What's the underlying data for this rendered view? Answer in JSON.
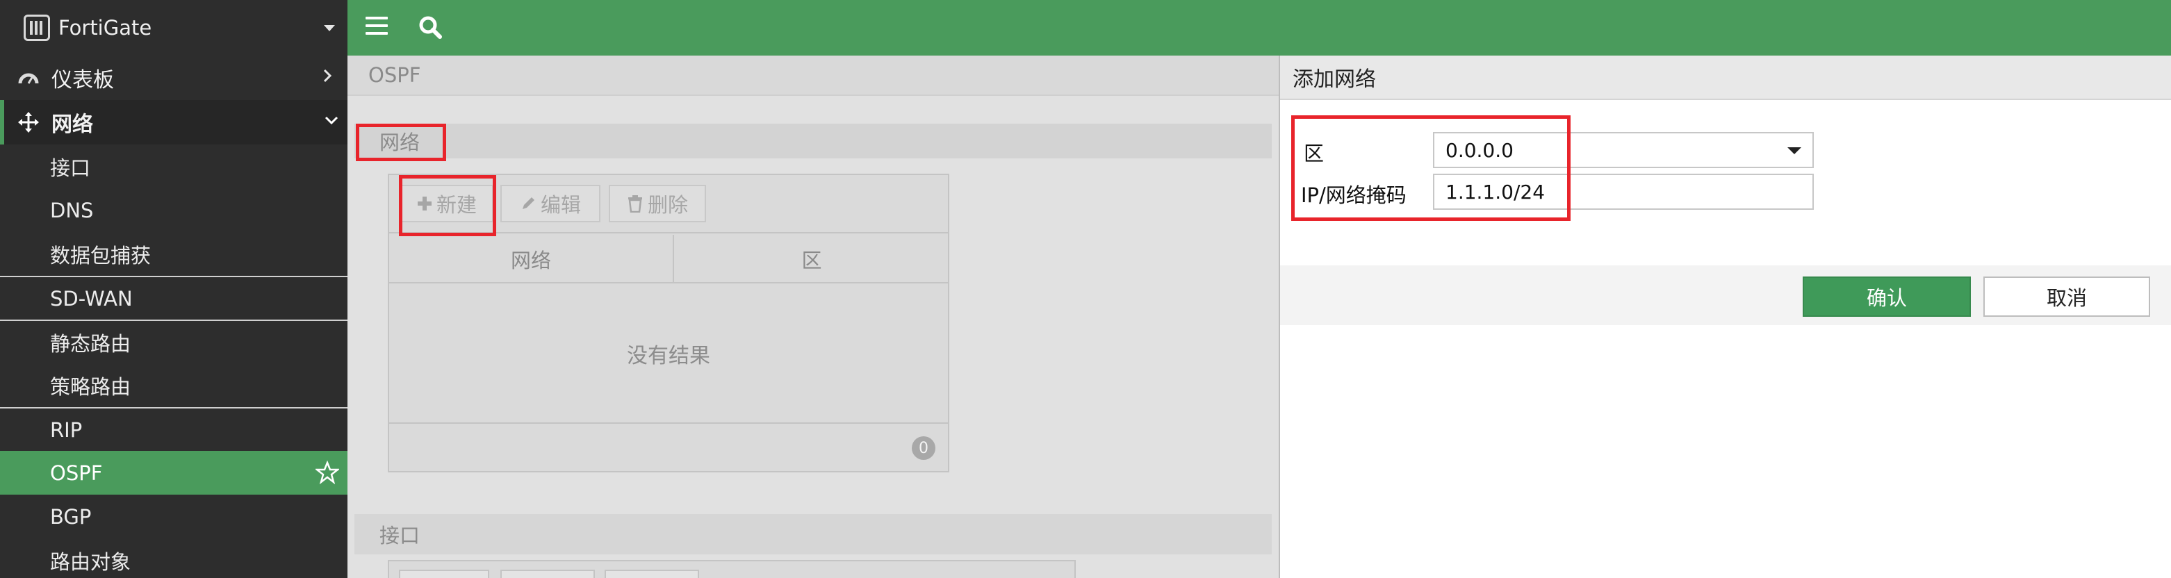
{
  "sidebar": {
    "brand": "FortiGate",
    "items": [
      {
        "label": "仪表板",
        "icon": "dashboard-icon"
      },
      {
        "label": "网络",
        "icon": "network-move-icon"
      }
    ],
    "sub_items": [
      {
        "label": "接口"
      },
      {
        "label": "DNS"
      },
      {
        "label": "数据包捕获"
      },
      {
        "label": "SD-WAN"
      },
      {
        "label": "静态路由"
      },
      {
        "label": "策略路由"
      },
      {
        "label": "RIP"
      },
      {
        "label": "OSPF",
        "selected": true
      },
      {
        "label": "BGP"
      },
      {
        "label": "路由对象"
      }
    ]
  },
  "topbar": {
    "menu_icon": "hamburger-menu-icon",
    "search_icon": "search-icon"
  },
  "main": {
    "breadcrumb": "OSPF",
    "network_section": {
      "title": "网络",
      "toolbar": {
        "new_label": "新建",
        "edit_label": "编辑",
        "delete_label": "删除"
      },
      "columns": [
        "网络",
        "区"
      ],
      "empty_text": "没有结果",
      "count": "0"
    },
    "interface_section": {
      "title": "接口"
    }
  },
  "dialog": {
    "title": "添加网络",
    "area_label": "区",
    "area_value": "0.0.0.0",
    "ipmask_label": "IP/网络掩码",
    "ipmask_value": "1.1.1.0/24",
    "ok_label": "确认",
    "cancel_label": "取消"
  },
  "colors": {
    "accent": "#4a9b5c",
    "sidebar_bg": "#2d2d2d",
    "highlight": "#e8242b",
    "ok_button": "#3f9a59"
  }
}
